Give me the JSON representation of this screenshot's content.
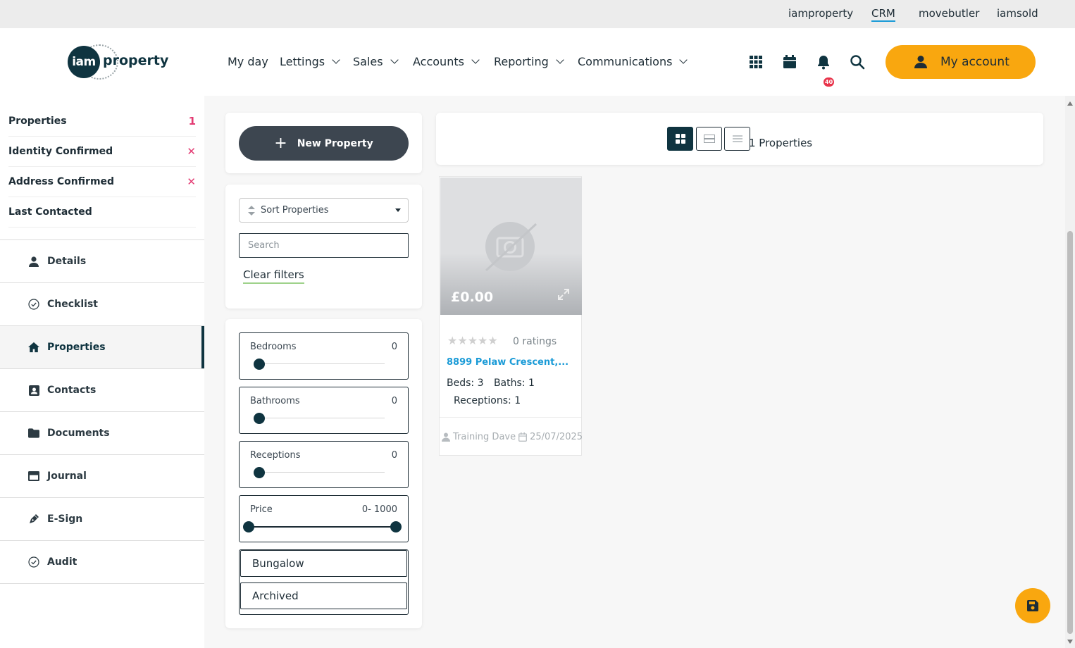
{
  "topbar": {
    "links": [
      "iamproperty",
      "CRM",
      "movebutler",
      "iamsold"
    ],
    "active": "CRM"
  },
  "logo": {
    "mark": "iam",
    "word": "property"
  },
  "nav": {
    "items": [
      "My day",
      "Lettings",
      "Sales",
      "Accounts",
      "Reporting",
      "Communications"
    ]
  },
  "header_icons": [
    "apps-grid-icon",
    "calendar-icon",
    "bell-icon",
    "search-icon"
  ],
  "notifications": {
    "count": "40"
  },
  "account": {
    "label": "My account"
  },
  "sidebar": {
    "stats": [
      {
        "label": "Properties",
        "value": "1"
      },
      {
        "label": "Identity Confirmed",
        "value": "✕"
      },
      {
        "label": "Address Confirmed",
        "value": "✕"
      },
      {
        "label": "Last Contacted",
        "value": ""
      }
    ],
    "items": [
      {
        "label": "Details",
        "icon": "user-icon"
      },
      {
        "label": "Checklist",
        "icon": "check-circle-icon"
      },
      {
        "label": "Properties",
        "icon": "home-icon",
        "active": true
      },
      {
        "label": "Contacts",
        "icon": "contact-card-icon"
      },
      {
        "label": "Documents",
        "icon": "folder-icon"
      },
      {
        "label": "Journal",
        "icon": "journal-icon"
      },
      {
        "label": "E-Sign",
        "icon": "pen-icon"
      },
      {
        "label": "Audit",
        "icon": "check-circle-icon"
      }
    ]
  },
  "actions": {
    "new_property": "New Property"
  },
  "filters": {
    "sort_placeholder": "Sort Properties",
    "search_placeholder": "Search",
    "clear": "Clear filters",
    "ranges": [
      {
        "label": "Bedrooms",
        "value": "0"
      },
      {
        "label": "Bathrooms",
        "value": "0"
      },
      {
        "label": "Receptions",
        "value": "0"
      },
      {
        "label": "Price",
        "value": "0- 1000"
      }
    ],
    "tags": [
      "Bungalow",
      "Archived"
    ]
  },
  "results": {
    "count": "1 Properties"
  },
  "card": {
    "price": "£0.00",
    "stars": "★★★★★",
    "ratings": "0 ratings",
    "address": "8899 Pelaw Crescent,...",
    "beds": "Beds: 3",
    "baths": "Baths: 1",
    "receptions": "Receptions: 1",
    "agent": "Training Dave",
    "date": "25/07/2025"
  },
  "colors": {
    "brand_dark": "#0f3440",
    "accent_orange": "#f9a70f",
    "link_blue": "#1b9bd7",
    "alert_pink": "#e33a72"
  }
}
